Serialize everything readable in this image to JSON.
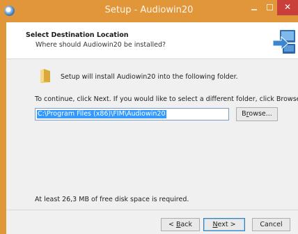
{
  "window": {
    "title": "Setup - Audiowin20",
    "minimize_glyph": "minimize",
    "maximize_glyph": "maximize",
    "close_label": "✕",
    "accent_color": "#e1963a",
    "close_color": "#c9403a"
  },
  "header": {
    "title": "Select Destination Location",
    "subtitle": "Where should Audiowin20 be installed?",
    "graphic_icon": "install-computer-icon"
  },
  "body": {
    "folder_icon": "folder-icon",
    "install_text": "Setup will install Audiowin20 into the following folder.",
    "continue_text": "To continue, click Next. If you would like to select a different folder, click Browse.",
    "path_value": "C:\\Program Files (x86)\\FIM\\Audiowin20",
    "browse_label_prefix": "B",
    "browse_label_accel": "r",
    "browse_label_suffix": "owse...",
    "disk_text": "At least 26,3 MB of free disk space is required."
  },
  "footer": {
    "back_prefix": "< ",
    "back_accel": "B",
    "back_suffix": "ack",
    "next_accel": "N",
    "next_suffix": "ext >",
    "cancel_label": "Cancel"
  }
}
